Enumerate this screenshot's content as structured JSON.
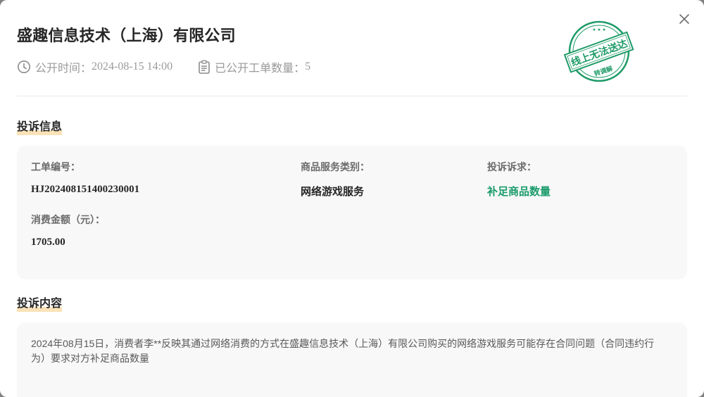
{
  "modal": {
    "title": "盛趣信息技术（上海）有限公司",
    "publish_time_label": "公开时间：",
    "publish_time_value": "2024-08-15 14:00",
    "tickets_label": "已公开工单数量：",
    "tickets_value": "5",
    "stamp": {
      "main_text": "线上无法送达",
      "sub_text": "转调解",
      "color": "#1e9b67"
    }
  },
  "sections": {
    "complaint_info": "投诉信息",
    "complaint_content": "投诉内容"
  },
  "info": {
    "ticket_no_label": "工单编号：",
    "ticket_no": "HJ20240815140023000​1",
    "category_label": "商品服务类别：",
    "category": "网络游戏服务",
    "demand_label": "投诉诉求：",
    "demand": "补足商品数量",
    "amount_label": "消费金额（元）：",
    "amount": "1705.00"
  },
  "content": {
    "text": "2024年08月15日，消费者李**反映其通过网络消费的方式在盛趣信息技术（上海）有限公司购买的网络游戏服务可能存在合同问题（合同违约行为）要求对方补足商品数量"
  },
  "colors": {
    "accent": "#1a9b6b",
    "highlight": "#fbe2b8"
  },
  "icons": [
    "close-icon",
    "clock-icon",
    "clipboard-icon"
  ]
}
